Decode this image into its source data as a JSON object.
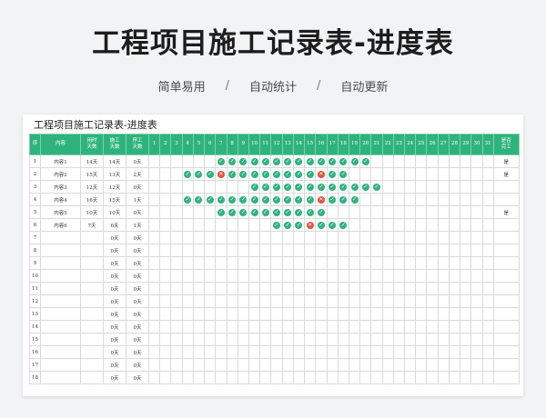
{
  "title": "工程项目施工记录表-进度表",
  "taglines": [
    "简单易用",
    "自动统计",
    "自动更新"
  ],
  "taglineSep": "/",
  "sheet": {
    "title": "工程项目施工记录表-进度表",
    "headers": {
      "seq": "序",
      "content": "内容",
      "planned": "用时\n天数",
      "worked": "施工\n天数",
      "stopped": "停工\n天数",
      "days": [
        "1",
        "2",
        "3",
        "4",
        "5",
        "6",
        "7",
        "8",
        "9",
        "10",
        "11",
        "12",
        "13",
        "14",
        "15",
        "16",
        "17",
        "18",
        "19",
        "20",
        "21",
        "22",
        "23",
        "24",
        "25",
        "26",
        "27",
        "28",
        "29",
        "30",
        "31"
      ],
      "done": "是否\n完工"
    },
    "rows": [
      {
        "seq": "1",
        "content": "内容1",
        "planned": "14天",
        "worked": "14天",
        "stopped": "0天",
        "done": "是",
        "marks": {
          "7": "ok",
          "8": "ok",
          "9": "ok",
          "10": "ok",
          "11": "ok",
          "12": "ok",
          "13": "ok",
          "14": "ok",
          "15": "ok",
          "16": "ok",
          "17": "ok",
          "18": "ok",
          "19": "ok",
          "20": "ok"
        }
      },
      {
        "seq": "2",
        "content": "内容2",
        "planned": "15天",
        "worked": "13天",
        "stopped": "2天",
        "done": "是",
        "marks": {
          "4": "ok",
          "5": "ok",
          "6": "ok",
          "7": "x",
          "8": "ok",
          "9": "ok",
          "10": "ok",
          "11": "ok",
          "12": "ok",
          "13": "ok",
          "14": "ok",
          "15": "ok",
          "16": "x",
          "17": "ok",
          "18": "ok"
        }
      },
      {
        "seq": "3",
        "content": "内容3",
        "planned": "12天",
        "worked": "12天",
        "stopped": "0天",
        "done": "",
        "marks": {
          "10": "ok",
          "11": "ok",
          "12": "ok",
          "13": "ok",
          "14": "ok",
          "15": "ok",
          "16": "ok",
          "17": "ok",
          "18": "ok",
          "19": "ok",
          "20": "ok",
          "21": "ok"
        }
      },
      {
        "seq": "4",
        "content": "内容4",
        "planned": "16天",
        "worked": "15天",
        "stopped": "1天",
        "done": "",
        "marks": {
          "4": "ok",
          "5": "ok",
          "6": "ok",
          "7": "ok",
          "8": "ok",
          "9": "ok",
          "10": "ok",
          "11": "ok",
          "12": "ok",
          "13": "ok",
          "14": "ok",
          "15": "ok",
          "16": "x",
          "17": "ok",
          "18": "ok",
          "19": "ok"
        }
      },
      {
        "seq": "5",
        "content": "内容5",
        "planned": "10天",
        "worked": "10天",
        "stopped": "0天",
        "done": "是",
        "marks": {
          "7": "ok",
          "8": "ok",
          "9": "ok",
          "10": "ok",
          "11": "ok",
          "12": "ok",
          "13": "ok",
          "14": "ok",
          "15": "ok",
          "16": "ok"
        }
      },
      {
        "seq": "6",
        "content": "内容6",
        "planned": "7天",
        "worked": "6天",
        "stopped": "1天",
        "done": "",
        "marks": {
          "12": "ok",
          "13": "ok",
          "14": "ok",
          "15": "x",
          "16": "ok",
          "17": "ok",
          "18": "ok"
        }
      },
      {
        "seq": "7",
        "content": "",
        "planned": "",
        "worked": "0天",
        "stopped": "0天",
        "done": "",
        "marks": {}
      },
      {
        "seq": "8",
        "content": "",
        "planned": "",
        "worked": "0天",
        "stopped": "0天",
        "done": "",
        "marks": {}
      },
      {
        "seq": "9",
        "content": "",
        "planned": "",
        "worked": "0天",
        "stopped": "0天",
        "done": "",
        "marks": {}
      },
      {
        "seq": "10",
        "content": "",
        "planned": "",
        "worked": "0天",
        "stopped": "0天",
        "done": "",
        "marks": {}
      },
      {
        "seq": "11",
        "content": "",
        "planned": "",
        "worked": "0天",
        "stopped": "0天",
        "done": "",
        "marks": {}
      },
      {
        "seq": "12",
        "content": "",
        "planned": "",
        "worked": "0天",
        "stopped": "0天",
        "done": "",
        "marks": {}
      },
      {
        "seq": "13",
        "content": "",
        "planned": "",
        "worked": "0天",
        "stopped": "0天",
        "done": "",
        "marks": {}
      },
      {
        "seq": "14",
        "content": "",
        "planned": "",
        "worked": "0天",
        "stopped": "0天",
        "done": "",
        "marks": {}
      },
      {
        "seq": "15",
        "content": "",
        "planned": "",
        "worked": "0天",
        "stopped": "0天",
        "done": "",
        "marks": {}
      },
      {
        "seq": "16",
        "content": "",
        "planned": "",
        "worked": "0天",
        "stopped": "0天",
        "done": "",
        "marks": {}
      },
      {
        "seq": "17",
        "content": "",
        "planned": "",
        "worked": "0天",
        "stopped": "0天",
        "done": "",
        "marks": {}
      },
      {
        "seq": "18",
        "content": "",
        "planned": "",
        "worked": "0天",
        "stopped": "0天",
        "done": "",
        "marks": {}
      }
    ],
    "markIcons": {
      "ok": "check-icon",
      "x": "cross-icon"
    },
    "markGlyphs": {
      "ok": "✓",
      "x": "✕"
    },
    "colors": {
      "header": "#2fb37e",
      "check": "#2fb37e",
      "cross": "#e0533d"
    }
  }
}
